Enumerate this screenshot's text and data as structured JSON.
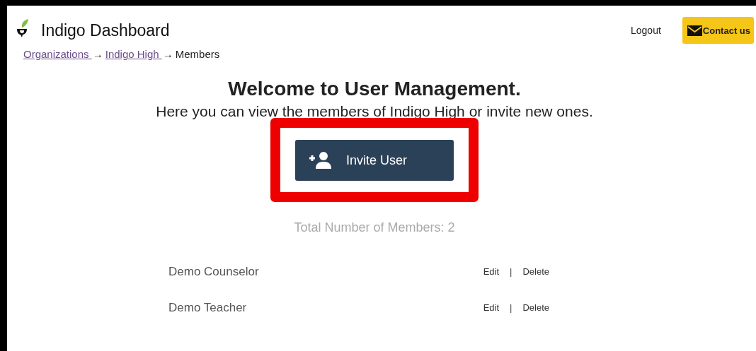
{
  "header": {
    "title": "Indigo Dashboard",
    "logout": "Logout",
    "contact": "Contact us"
  },
  "breadcrumb": {
    "links": [
      "Organizations ",
      "Indigo High "
    ],
    "separator": "→",
    "current": "Members"
  },
  "heading": "Welcome to User Management.",
  "subtitle": "Here you can view the members of Indigo High or invite new ones.",
  "invite_button": {
    "label": "Invite User",
    "highlighted": true
  },
  "total": "Total Number of Members: 2",
  "members": [
    {
      "name": "Demo Counselor",
      "edit": "Edit",
      "separator": "|",
      "delete": "Delete"
    },
    {
      "name": "Demo Teacher",
      "edit": "Edit",
      "separator": "|",
      "delete": "Delete"
    }
  ]
}
